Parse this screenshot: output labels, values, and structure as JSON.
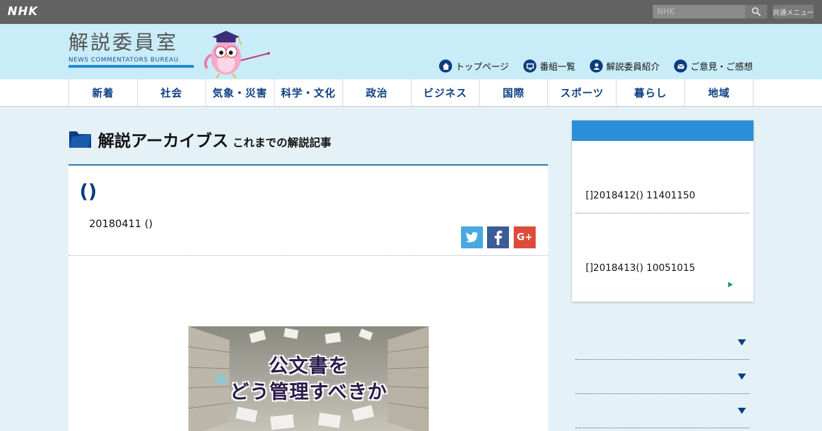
{
  "topbar": {
    "logo": "NHK",
    "search_placeholder": "NHK",
    "menu_label": "共通メニュー"
  },
  "header": {
    "title": "解説委員室",
    "subtitle": "NEWS COMMENTATORS BUREAU",
    "links": [
      {
        "label": "トップページ",
        "icon": "home-icon"
      },
      {
        "label": "番組一覧",
        "icon": "tv-icon"
      },
      {
        "label": "解説委員紹介",
        "icon": "person-icon"
      },
      {
        "label": "ご意見・ご感想",
        "icon": "mail-icon"
      }
    ]
  },
  "nav": {
    "items": [
      "新着",
      "社会",
      "気象・災害",
      "科学・文化",
      "政治",
      "ビジネス",
      "国際",
      "スポーツ",
      "暮らし",
      "地域"
    ]
  },
  "archive": {
    "title": "解説アーカイブス",
    "subtitle": "これまでの解説記事"
  },
  "article": {
    "title": "()",
    "date": "20180411 ()",
    "image_caption_line1": "公文書を",
    "image_caption_line2": "どう管理すべきか"
  },
  "sidebar": {
    "entries": [
      "[]2018412() 11401150",
      "[]2018413() 10051015"
    ]
  },
  "colors": {
    "topbar": "#626262",
    "header": "#c8ecf8",
    "nav_text": "#0c3f82",
    "sidebar_header": "#2a8fd6",
    "page_bg": "#e4f1f6"
  }
}
